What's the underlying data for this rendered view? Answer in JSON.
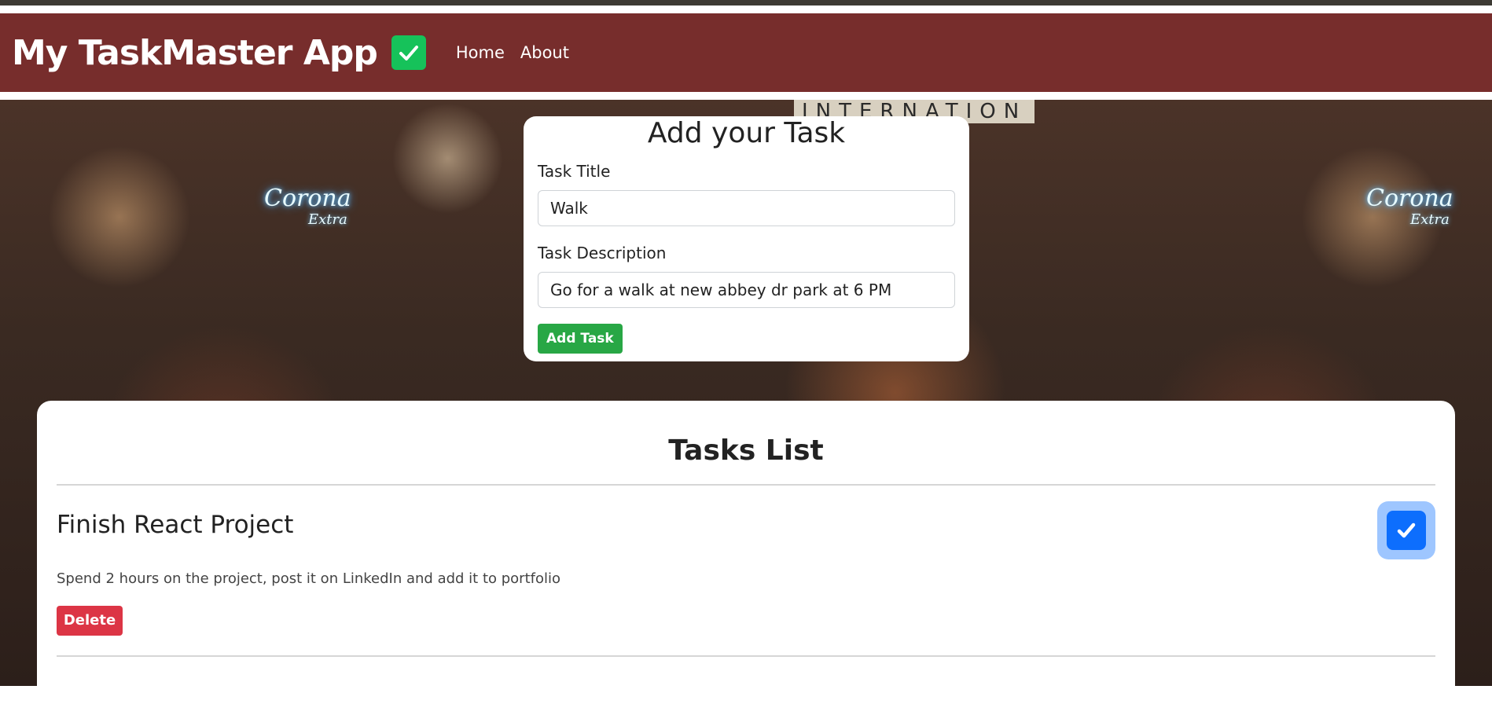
{
  "app": {
    "title": "My TaskMaster App",
    "brand_icon": "check-icon"
  },
  "nav": {
    "items": [
      {
        "label": "Home"
      },
      {
        "label": "About"
      }
    ]
  },
  "background": {
    "signs": [
      {
        "text": "Corona"
      },
      {
        "text": "Extra"
      },
      {
        "text": "Corona"
      },
      {
        "text": "Extra"
      }
    ],
    "banner": "INTERNATION"
  },
  "form": {
    "title": "Add your Task",
    "title_label": "Task Title",
    "title_value": "Walk",
    "description_label": "Task Description",
    "description_value": "Go for a walk at new abbey dr park at 6 PM",
    "submit_label": "Add Task"
  },
  "tasks": {
    "heading": "Tasks List",
    "items": [
      {
        "title": "Finish React Project",
        "description": "Spend 2 hours on the project, post it on LinkedIn and add it to portfolio",
        "delete_label": "Delete",
        "completed": true
      }
    ]
  },
  "colors": {
    "navbar": "#772d2c",
    "brand_check": "#16c25a",
    "add_button": "#28a745",
    "delete_button": "#dc3545",
    "task_check": "#0d6efd"
  }
}
